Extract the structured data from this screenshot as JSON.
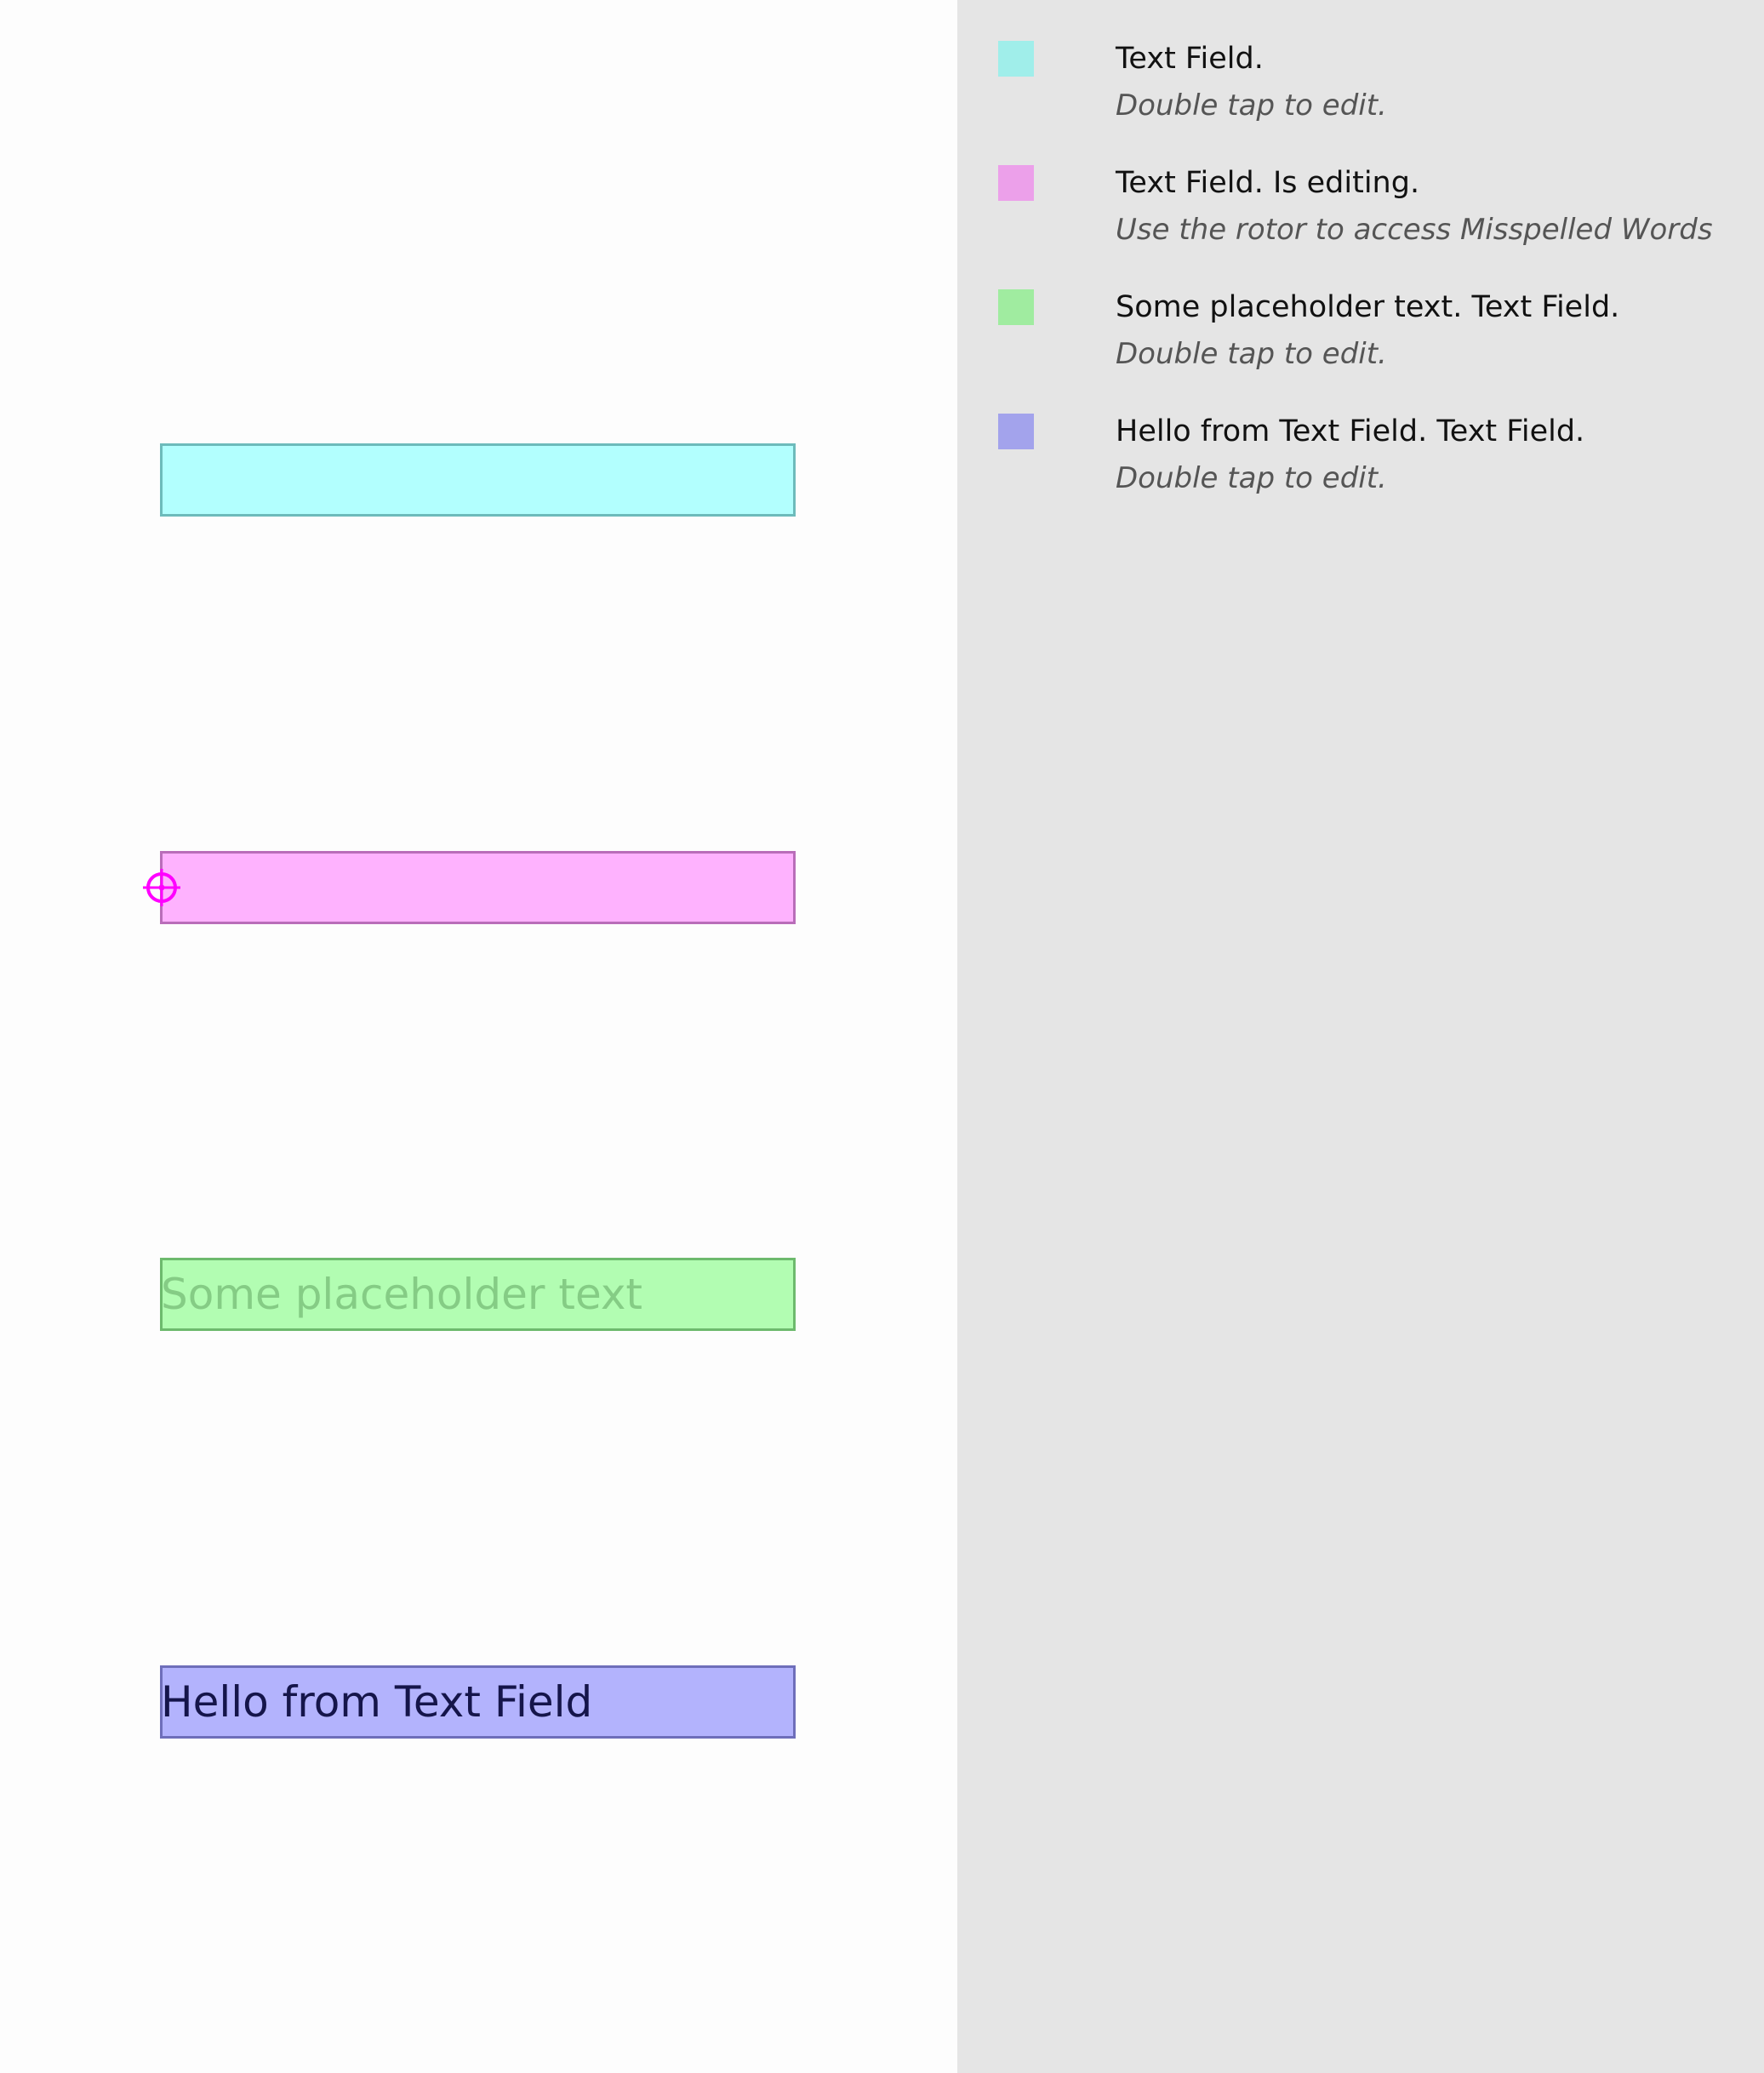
{
  "canvas": {
    "fields": [
      {
        "name": "text-field-empty",
        "text": "",
        "placeholder": "",
        "fill": "#b2fffe",
        "stroke": "#6dbbbb"
      },
      {
        "name": "text-field-editing",
        "text": "",
        "placeholder": "",
        "fill": "#feb2fe",
        "stroke": "#b96db9"
      },
      {
        "name": "text-field-placeholder",
        "text": "",
        "placeholder": "Some placeholder text",
        "fill": "#b2fdb2",
        "stroke": "#6dba6d"
      },
      {
        "name": "text-field-filled",
        "text": "Hello from Text Field",
        "placeholder": "",
        "fill": "#b3b3fd",
        "stroke": "#6e6eba"
      }
    ],
    "focus_indicator": {
      "icon": "crosshair-icon",
      "color": "#ff00ff"
    }
  },
  "legend": {
    "items": [
      {
        "swatch": "#a0eeea",
        "title": "Text Field.",
        "hint": "Double tap to edit."
      },
      {
        "swatch": "#eca0ea",
        "title": "Text Field. Is editing.",
        "hint": "Use the rotor to access Misspelled Words"
      },
      {
        "swatch": "#a0eca0",
        "title": "Some placeholder text. Text Field.",
        "hint": "Double tap to edit."
      },
      {
        "swatch": "#a3a3ec",
        "title": "Hello from Text Field. Text Field.",
        "hint": "Double tap to edit."
      }
    ]
  }
}
